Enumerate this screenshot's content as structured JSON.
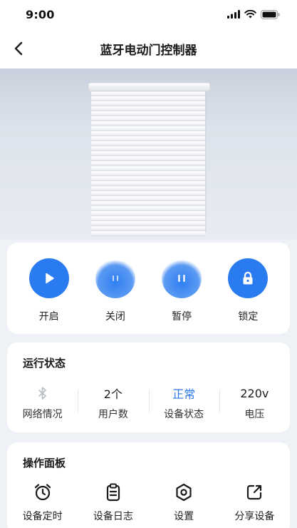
{
  "status_bar": {
    "time": "9:00"
  },
  "header": {
    "title": "蓝牙电动门控制器"
  },
  "controls": [
    {
      "label": "开启",
      "icon": "play-icon"
    },
    {
      "label": "关闭",
      "icon": "close-door-icon"
    },
    {
      "label": "暂停",
      "icon": "pause-icon"
    },
    {
      "label": "锁定",
      "icon": "lock-icon"
    }
  ],
  "run_status": {
    "title": "运行状态",
    "items": [
      {
        "value": "",
        "label": "网络情况",
        "icon": "bluetooth-icon"
      },
      {
        "value": "2个",
        "label": "用户数"
      },
      {
        "value": "正常",
        "label": "设备状态"
      },
      {
        "value": "220v",
        "label": "电压"
      }
    ]
  },
  "panel": {
    "title": "操作面板",
    "items": [
      {
        "label": "设备定时",
        "icon": "alarm-clock-icon"
      },
      {
        "label": "设备日志",
        "icon": "clipboard-icon"
      },
      {
        "label": "设置",
        "icon": "settings-hex-icon"
      },
      {
        "label": "分享设备",
        "icon": "share-icon"
      }
    ]
  },
  "colors": {
    "accent": "#2b7bf0",
    "background": "#eef1f6",
    "card": "#ffffff"
  }
}
